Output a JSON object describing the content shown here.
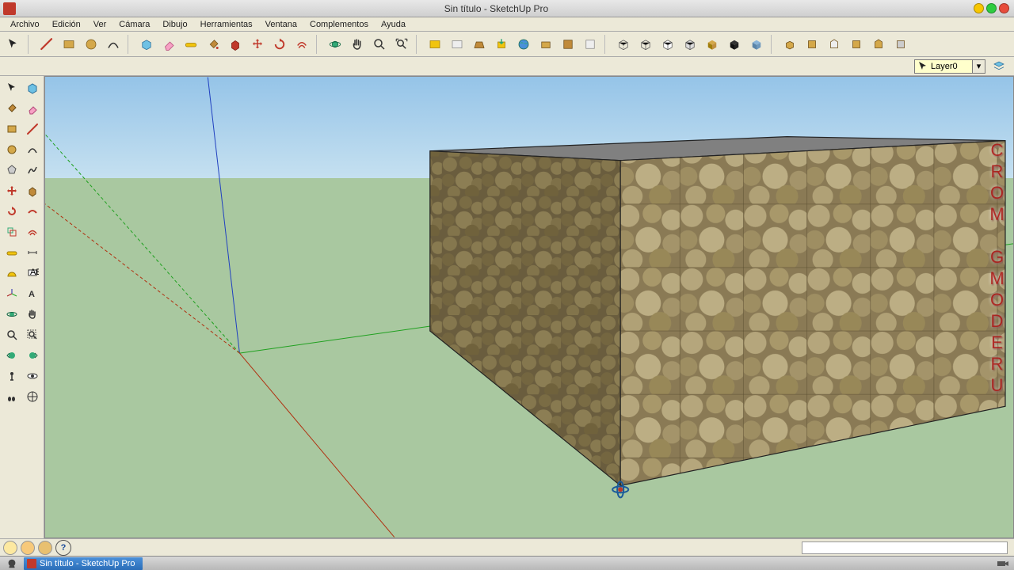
{
  "window": {
    "title": "Sin título - SketchUp Pro"
  },
  "menu": {
    "items": [
      "Archivo",
      "Edición",
      "Ver",
      "Cámara",
      "Dibujo",
      "Herramientas",
      "Ventana",
      "Complementos",
      "Ayuda"
    ]
  },
  "toolbar_top": {
    "groups": [
      [
        "select-tool",
        "line-tool",
        "rectangle-tool",
        "circle-tool",
        "arc-tool"
      ],
      [
        "make-component",
        "eraser-tool",
        "tape-measure",
        "paint-bucket",
        "push-pull",
        "move-tool",
        "rotate-tool",
        "offset-tool"
      ],
      [
        "orbit-tool",
        "pan-tool",
        "zoom-tool",
        "zoom-extents"
      ],
      [
        "get-models",
        "share-model",
        "outliner-tool",
        "component-tool",
        "3d-warehouse",
        "send-to-layout",
        "google-earth",
        "place-model"
      ],
      [
        "xray-mode",
        "back-edges",
        "wireframe",
        "hidden-line",
        "shaded",
        "shaded-textures",
        "monochrome"
      ],
      [
        "iso-view",
        "top-view",
        "front-view",
        "right-view",
        "back-view",
        "left-view"
      ]
    ]
  },
  "layer": {
    "current": "Layer0"
  },
  "side_tools": [
    "select-tool",
    "make-component",
    "paint-bucket",
    "eraser-tool",
    "rectangle-tool",
    "line-tool",
    "circle-tool",
    "arc-tool",
    "polygon-tool",
    "freehand-tool",
    "move-tool",
    "push-pull",
    "rotate-tool",
    "follow-me",
    "scale-tool",
    "offset-tool",
    "tape-measure",
    "dimension-tool",
    "protractor-tool",
    "text-tool",
    "axes-tool",
    "3d-text",
    "orbit-tool",
    "pan-tool",
    "zoom-tool",
    "zoom-window",
    "previous-tool",
    "next-tool",
    "position-camera",
    "look-around",
    "walk-tool",
    "section-plane"
  ],
  "watermark": {
    "text": "CROM GMODERU"
  },
  "taskbar": {
    "active_task": "Sin título - SketchUp Pro"
  },
  "statusbar": {
    "help_symbol": "?"
  }
}
